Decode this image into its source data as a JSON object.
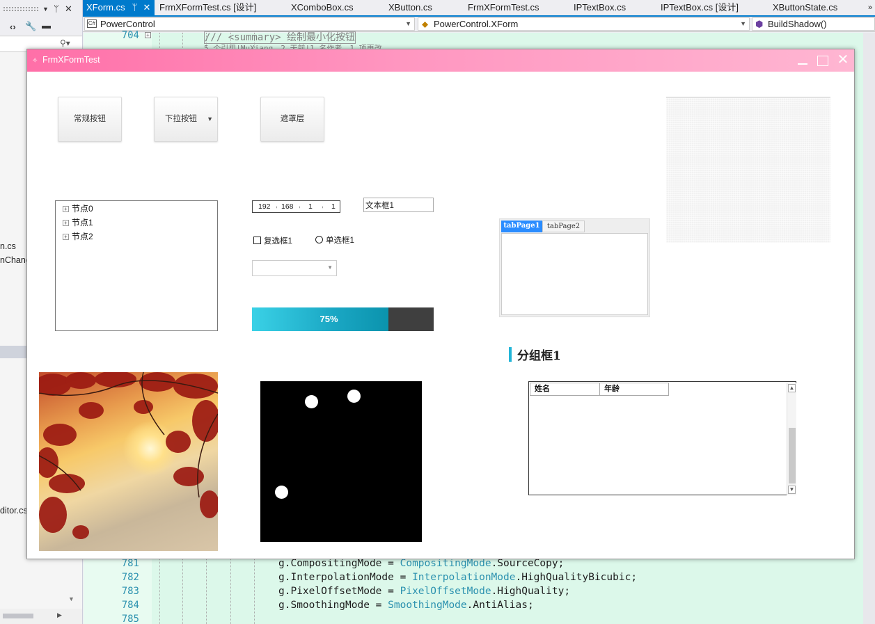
{
  "ide": {
    "left_panel": {
      "partial_items": [
        "n.cs",
        "nChang",
        "ditor.cs"
      ],
      "pin_icon": "pin-icon",
      "close_icon": "close-icon"
    },
    "tabs": [
      {
        "label": "XForm.cs",
        "active": true
      },
      {
        "label": "FrmXFormTest.cs [设计]"
      },
      {
        "label": "XComboBox.cs"
      },
      {
        "label": "XButton.cs"
      },
      {
        "label": "FrmXFormTest.cs"
      },
      {
        "label": "IPTextBox.cs"
      },
      {
        "label": "IPTextBox.cs [设计]"
      },
      {
        "label": "XButtonState.cs"
      }
    ],
    "nav": {
      "project": "PowerControl",
      "type": "PowerControl.XForm",
      "member": "BuildShadow()"
    },
    "code_top": {
      "line_no": "704",
      "summary": "/// <summary> 绘制最小化按钮",
      "codelens": "5 个引用|MuXiang，2 天前|1 名作者，1 项更改"
    },
    "code_lines": [
      {
        "no": "781",
        "pre": "g.CompositingMode = ",
        "type": "CompositingMode",
        "post": ".SourceCopy;"
      },
      {
        "no": "782",
        "pre": "g.InterpolationMode = ",
        "type": "InterpolationMode",
        "post": ".HighQualityBicubic;"
      },
      {
        "no": "783",
        "pre": "g.PixelOffsetMode = ",
        "type": "PixelOffsetMode",
        "post": ".HighQuality;"
      },
      {
        "no": "784",
        "pre": "g.SmoothingMode = ",
        "type": "SmoothingMode",
        "post": ".AntiAlias;"
      },
      {
        "no": "785",
        "pre": "",
        "type": "",
        "post": ""
      }
    ],
    "colors": {
      "accent": "#007acc",
      "code_bg": "#dcf8ea",
      "type_color": "#2b91af"
    }
  },
  "dialog": {
    "title": "FrmXFormTest",
    "titlebar_gradient": [
      "#ff6fa8",
      "#ffb6d2"
    ],
    "buttons": {
      "normal": "常规按钮",
      "dropdown": "下拉按钮",
      "mask": "遮罩层"
    },
    "tree": {
      "nodes": [
        "节点0",
        "节点1",
        "节点2"
      ]
    },
    "ip": {
      "seg1": "192",
      "seg2": "168",
      "seg3": "1",
      "seg4": "1"
    },
    "textbox": "文本框1",
    "checkbox_label": "复选框1",
    "radio_label": "单选框1",
    "progress": {
      "value": 75,
      "label": "75%"
    },
    "tabs": {
      "page1": "tabPage1",
      "page2": "tabPage2"
    },
    "groupbox_title": "分组框1",
    "listview": {
      "columns": [
        "姓名",
        "年龄"
      ]
    }
  }
}
